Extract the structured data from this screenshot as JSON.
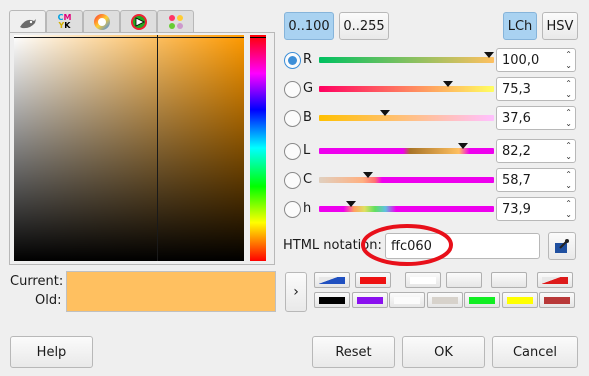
{
  "tabs": [
    {
      "icon": "gimp-wilber-icon"
    },
    {
      "icon": "cmyk-icon",
      "text_top": "C M",
      "text_bottom": "Y K"
    },
    {
      "icon": "color-wheel-icon"
    },
    {
      "icon": "color-triangle-icon"
    },
    {
      "icon": "palette-icon"
    }
  ],
  "range_buttons": {
    "range_100": "0..100",
    "range_255": "0..255"
  },
  "model_buttons": {
    "lch": "LCh",
    "hsv": "HSV"
  },
  "channels": [
    {
      "label": "R",
      "value": "100,0",
      "checked": true
    },
    {
      "label": "G",
      "value": "75,3",
      "checked": false
    },
    {
      "label": "B",
      "value": "37,6",
      "checked": false
    },
    {
      "label": "L",
      "value": "82,2",
      "checked": false
    },
    {
      "label": "C",
      "value": "58,7",
      "checked": false
    },
    {
      "label": "h",
      "value": "73,9",
      "checked": false
    }
  ],
  "html_notation": {
    "label": "HTML notation:",
    "value": "ffc060"
  },
  "current_label": "Current:",
  "old_label": "Old:",
  "current_color": "#ffc060",
  "history_colors": [
    [
      "#3050c8",
      "#ee1111",
      "#ffffff",
      "#ececec",
      "#ececec",
      "#dd1a1a"
    ],
    [
      "#000000",
      "#8a10ef",
      "#fbfbfb",
      "#d7d2cb",
      "#11ee22",
      "#ffff00",
      "#b83838"
    ]
  ],
  "buttons": {
    "help": "Help",
    "reset": "Reset",
    "ok": "OK",
    "cancel": "Cancel"
  }
}
